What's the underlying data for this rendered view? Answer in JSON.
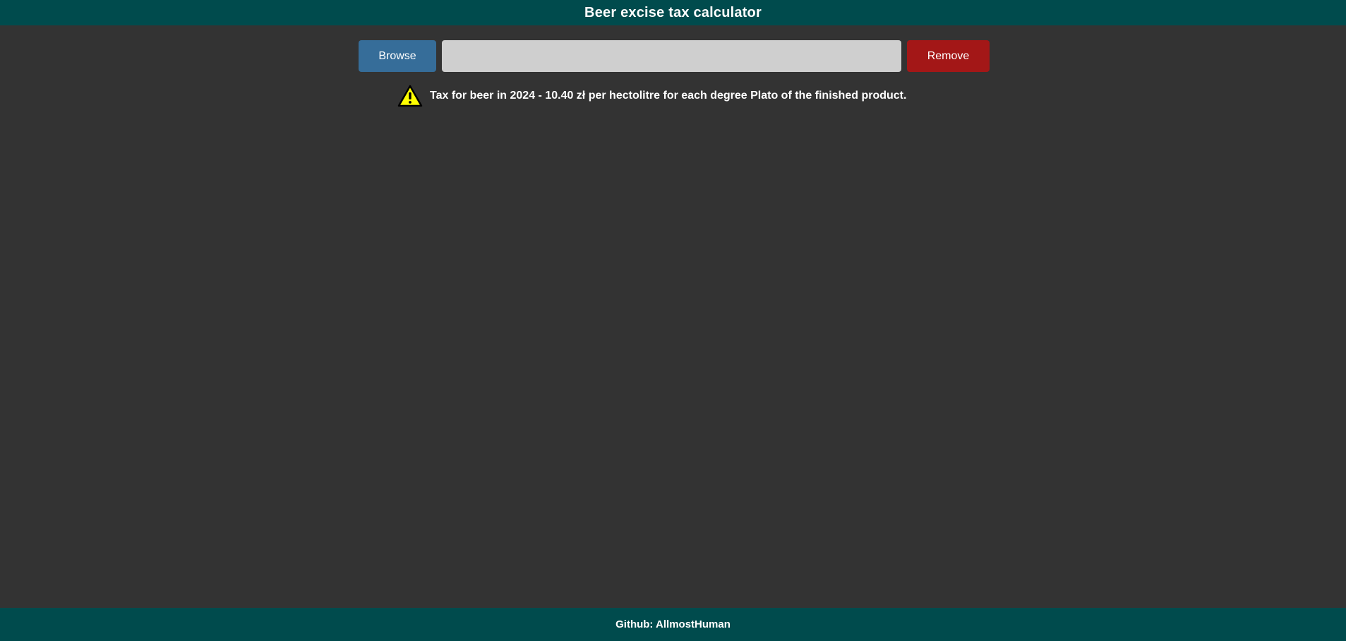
{
  "header": {
    "title": "Beer excise tax calculator",
    "background": "#004b4d"
  },
  "file_picker": {
    "browse_label": "Browse",
    "file_value": "",
    "remove_label": "Remove",
    "browse_color": "#366d99",
    "remove_color": "#a31717"
  },
  "notice": {
    "icon": "warning-icon",
    "text": "Tax for beer in 2024 - 10.40 zł per hectolitre for each degree Plato of the finished product."
  },
  "footer": {
    "text": "Github: AllmostHuman"
  },
  "colors": {
    "page_background": "#333333",
    "warning_yellow": "#ffff00"
  }
}
